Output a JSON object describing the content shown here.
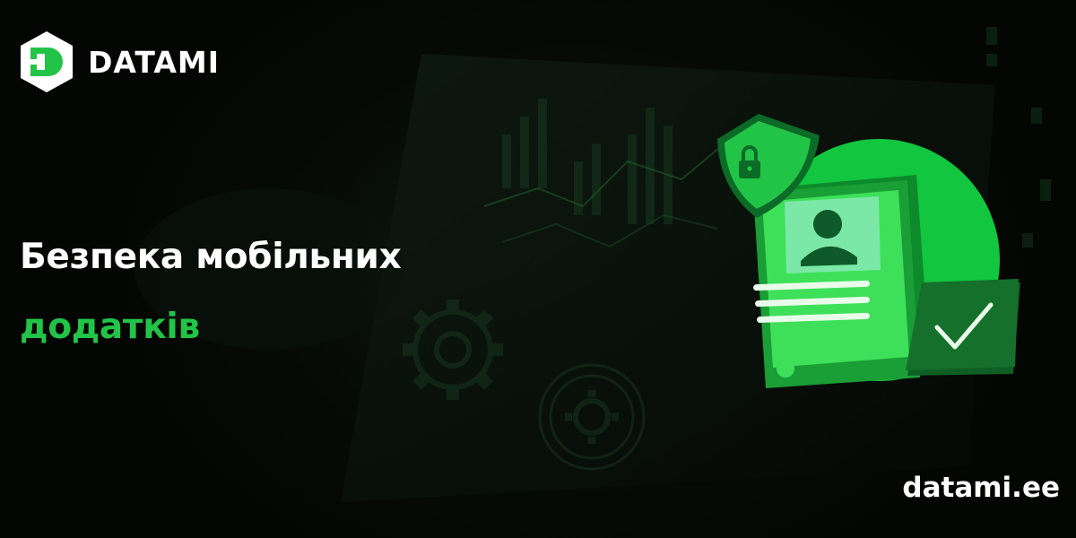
{
  "brand": {
    "name": "DATAMI",
    "url": "datami.ee"
  },
  "headline": {
    "line1": "Безпека мобільних",
    "line2": "додатків"
  },
  "colors": {
    "background": "#050805",
    "accent_green": "#22c447",
    "bright_green": "#3ee05a",
    "text": "#ffffff"
  },
  "icons": {
    "logo": "datami-hexagon-logo",
    "shield": "shield-lock-icon",
    "phone": "smartphone-profile-icon",
    "check": "checkmark-icon"
  }
}
